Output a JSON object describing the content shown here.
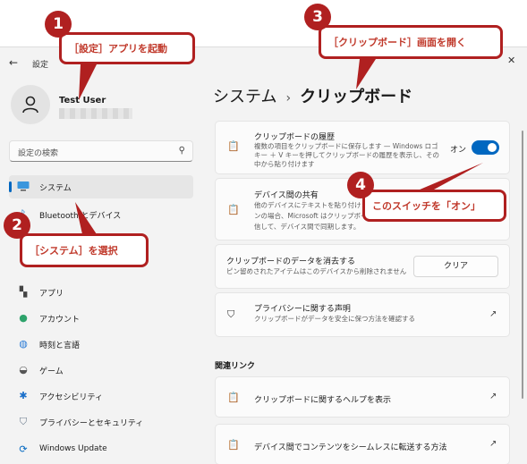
{
  "window": {
    "app_title": "設定",
    "back_glyph": "←",
    "close_glyph": "✕"
  },
  "user": {
    "name": "Test User"
  },
  "search": {
    "placeholder": "設定の検索"
  },
  "sidebar": {
    "items": [
      {
        "label": "システム",
        "icon": "monitor-icon"
      },
      {
        "label": "Bluetooth とデバイス",
        "icon": "bluetooth-icon"
      },
      {
        "label": "アプリ",
        "icon": "apps-icon"
      },
      {
        "label": "アカウント",
        "icon": "person-icon"
      },
      {
        "label": "時刻と言語",
        "icon": "globe-clock-icon"
      },
      {
        "label": "ゲーム",
        "icon": "gamepad-icon"
      },
      {
        "label": "アクセシビリティ",
        "icon": "accessibility-icon"
      },
      {
        "label": "プライバシーとセキュリティ",
        "icon": "shield-icon"
      },
      {
        "label": "Windows Update",
        "icon": "update-icon"
      }
    ]
  },
  "breadcrumb": {
    "parent": "システム",
    "separator": "›",
    "current": "クリップボード"
  },
  "cards": {
    "history": {
      "title": "クリップボードの履歴",
      "desc_1": "複数の項目をクリップボードに保存します — Windows ロゴ",
      "desc_2": "キー ＋ V キーを押してクリップボードの履歴を表示し、その",
      "desc_3": "中から貼り付けます",
      "toggle_label": "オン"
    },
    "share": {
      "title": "デバイス間の共有",
      "desc_1": "他のデバイスにテキストを貼り付けます",
      "desc_2": "ンの場合、Microsoft はクリップボー",
      "desc_3": "信して、デバイス間で同期します。"
    },
    "clear": {
      "title": "クリップボードのデータを消去する",
      "desc": "ピン留めされたアイテムはこのデバイスから削除されません",
      "button": "クリア"
    },
    "privacy": {
      "title": "プライバシーに関する声明",
      "desc": "クリップボードがデータを安全に保つ方法を確認する"
    }
  },
  "related": {
    "heading": "関連リンク",
    "links": [
      {
        "label": "クリップボードに関するヘルプを表示"
      },
      {
        "label": "デバイス間でコンテンツをシームレスに転送する方法"
      }
    ]
  },
  "annotations": {
    "a1": {
      "num": "1",
      "text": "［設定］アプリを起動"
    },
    "a2": {
      "num": "2",
      "text": "［システム］を選択"
    },
    "a3": {
      "num": "3",
      "text": "［クリップボード］画面を開く"
    },
    "a4": {
      "num": "4",
      "text": "このスイッチを「オン」"
    }
  },
  "colors": {
    "accent": "#0067c0",
    "annotation": "#b02020"
  }
}
